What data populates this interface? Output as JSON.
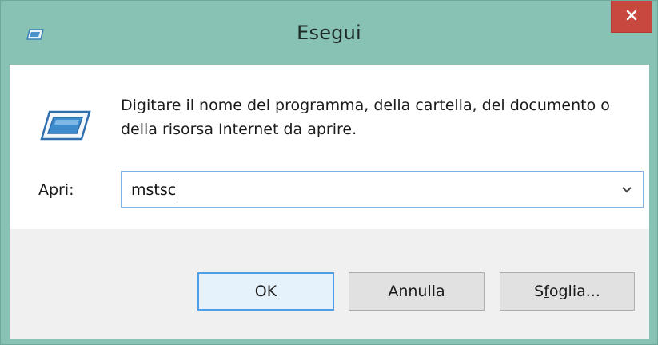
{
  "window": {
    "title": "Esegui",
    "title_bar_color": "#88c2b4",
    "close_color": "#c8473f"
  },
  "icons": {
    "title": "run-dialog-icon",
    "main": "run-program-icon",
    "close": "close-icon",
    "dropdown": "chevron-down-icon"
  },
  "content": {
    "description": "Digitare il nome del programma, della cartella, del documento o della risorsa Internet da aprire.",
    "open_label_underlined": "A",
    "open_label_rest": "pri:",
    "open_value": "mstsc"
  },
  "buttons": {
    "ok": "OK",
    "cancel": "Annulla",
    "browse_pre": "S",
    "browse_underlined": "f",
    "browse_post": "oglia..."
  }
}
